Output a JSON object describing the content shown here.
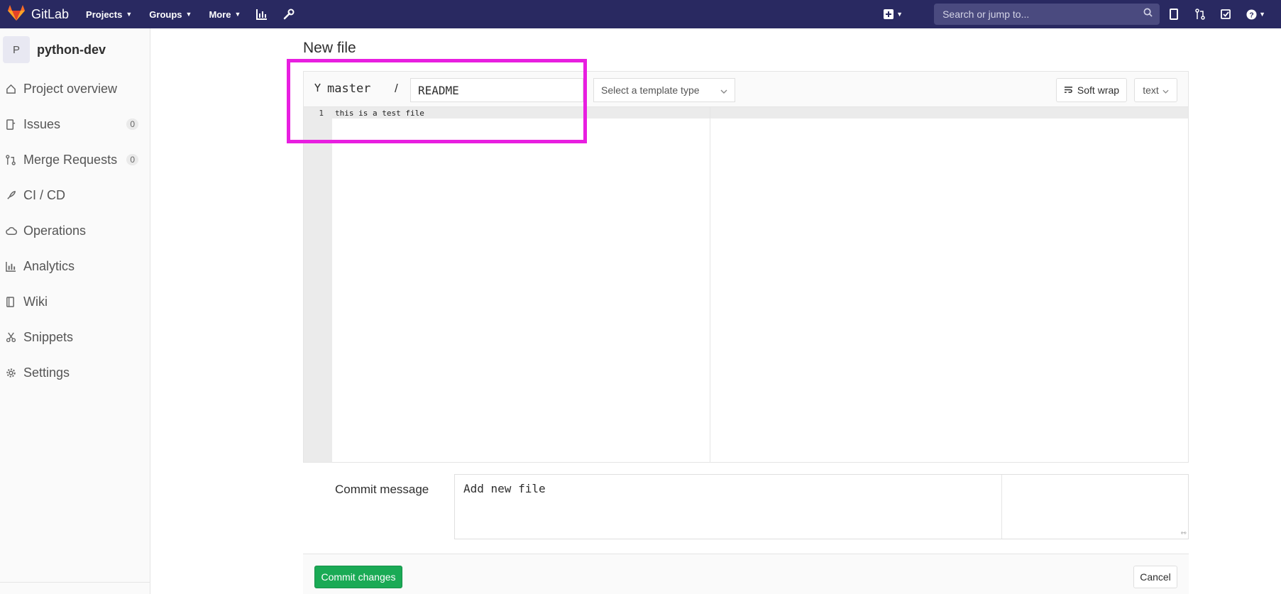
{
  "navbar": {
    "brand": "GitLab",
    "projects": "Projects",
    "groups": "Groups",
    "more": "More",
    "search_placeholder": "Search or jump to..."
  },
  "sidebar": {
    "avatar_letter": "P",
    "project_name": "python-dev",
    "items": [
      {
        "label": "Project overview",
        "icon": "home-icon"
      },
      {
        "label": "Issues",
        "icon": "issues-icon",
        "badge": "0"
      },
      {
        "label": "Merge Requests",
        "icon": "merge-request-icon",
        "badge": "0"
      },
      {
        "label": "CI / CD",
        "icon": "rocket-icon"
      },
      {
        "label": "Operations",
        "icon": "cloud-gear-icon"
      },
      {
        "label": "Analytics",
        "icon": "chart-icon"
      },
      {
        "label": "Wiki",
        "icon": "book-icon"
      },
      {
        "label": "Snippets",
        "icon": "scissors-icon"
      },
      {
        "label": "Settings",
        "icon": "gear-icon"
      }
    ]
  },
  "main": {
    "title": "New file",
    "branch": "master",
    "separator": "/",
    "filename": "README",
    "template_select": "Select a template type",
    "soft_wrap": "Soft wrap",
    "mode": "text",
    "editor": {
      "line_number": "1",
      "line_text": "this is a test file"
    },
    "commit_label": "Commit message",
    "commit_message": "Add new file",
    "commit_button": "Commit changes",
    "cancel_button": "Cancel"
  },
  "colors": {
    "navbar": "#292961",
    "highlight": "#e81ee0",
    "commit_button": "#1aaa55"
  }
}
